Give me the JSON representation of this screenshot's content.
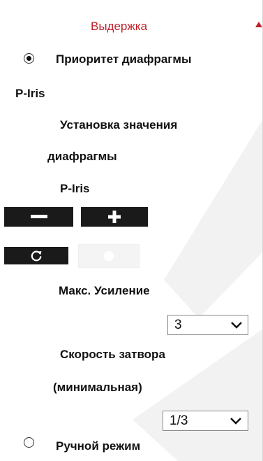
{
  "section": {
    "title": "Выдержка",
    "accent_color": "#c0202a",
    "collapse_icon": "triangle-up-icon"
  },
  "exposure_modes": {
    "aperture_priority_label": "Приоритет диафрагмы",
    "aperture_priority_selected": true,
    "manual_label": "Ручной режим",
    "manual_selected": false
  },
  "iris": {
    "type_label": "P-Iris",
    "set_value_line1": "Установка значения",
    "set_value_line2": "диафрагмы",
    "control_label": "P-Iris",
    "decrease_icon": "minus-icon",
    "increase_icon": "plus-icon",
    "reset_icon": "refresh-icon"
  },
  "gain": {
    "label": "Макс. Усиление",
    "value": "3",
    "dropdown_icon": "chevron-down-icon"
  },
  "shutter": {
    "label_line1": "Скорость затвора",
    "label_line2": "(минимальная)",
    "value": "1/3",
    "dropdown_icon": "chevron-down-icon"
  }
}
